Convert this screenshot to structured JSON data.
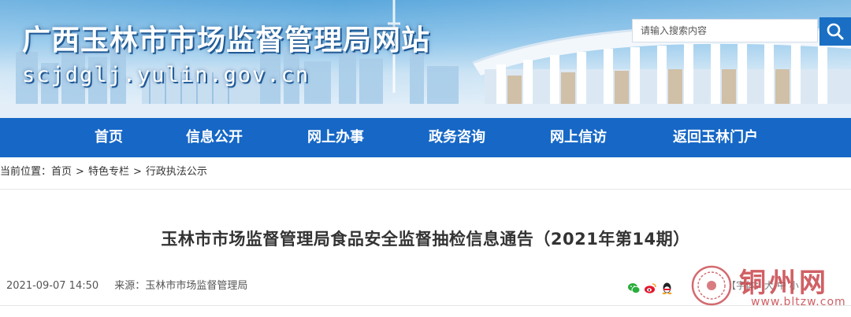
{
  "header": {
    "site_title": "广西玉林市市场监督管理局网站",
    "site_domain": "scjdglj.yulin.gov.cn",
    "search": {
      "placeholder": "请输入搜索内容",
      "button_icon": "search-icon"
    }
  },
  "nav": {
    "items": [
      {
        "label": "首页"
      },
      {
        "label": "信息公开"
      },
      {
        "label": "网上办事"
      },
      {
        "label": "政务咨询"
      },
      {
        "label": "网上信访"
      },
      {
        "label": "返回玉林门户"
      }
    ]
  },
  "breadcrumb": {
    "prefix": "当前位置：",
    "items": [
      {
        "label": "首页"
      },
      {
        "label": "特色专栏"
      },
      {
        "label": "行政执法公示"
      }
    ],
    "separator": ">"
  },
  "article": {
    "title": "玉林市市场监督管理局食品安全监督抽检信息通告（2021年第14期）",
    "date": "2021-09-07 14:50",
    "source_label": "来源：",
    "source": "玉林市市场监督管理局",
    "share_icons": [
      "wechat-icon",
      "weibo-icon",
      "qq-icon"
    ],
    "font_size_label": "【字体：",
    "font_size_options": [
      "大",
      "中",
      "小"
    ]
  },
  "watermark": {
    "text": "铜州网",
    "url": "www.bltzw.com"
  },
  "colors": {
    "nav_bg": "#1667c6",
    "search_button": "#1a6fc4",
    "title_text": "#333333",
    "watermark": "#c8454b"
  }
}
